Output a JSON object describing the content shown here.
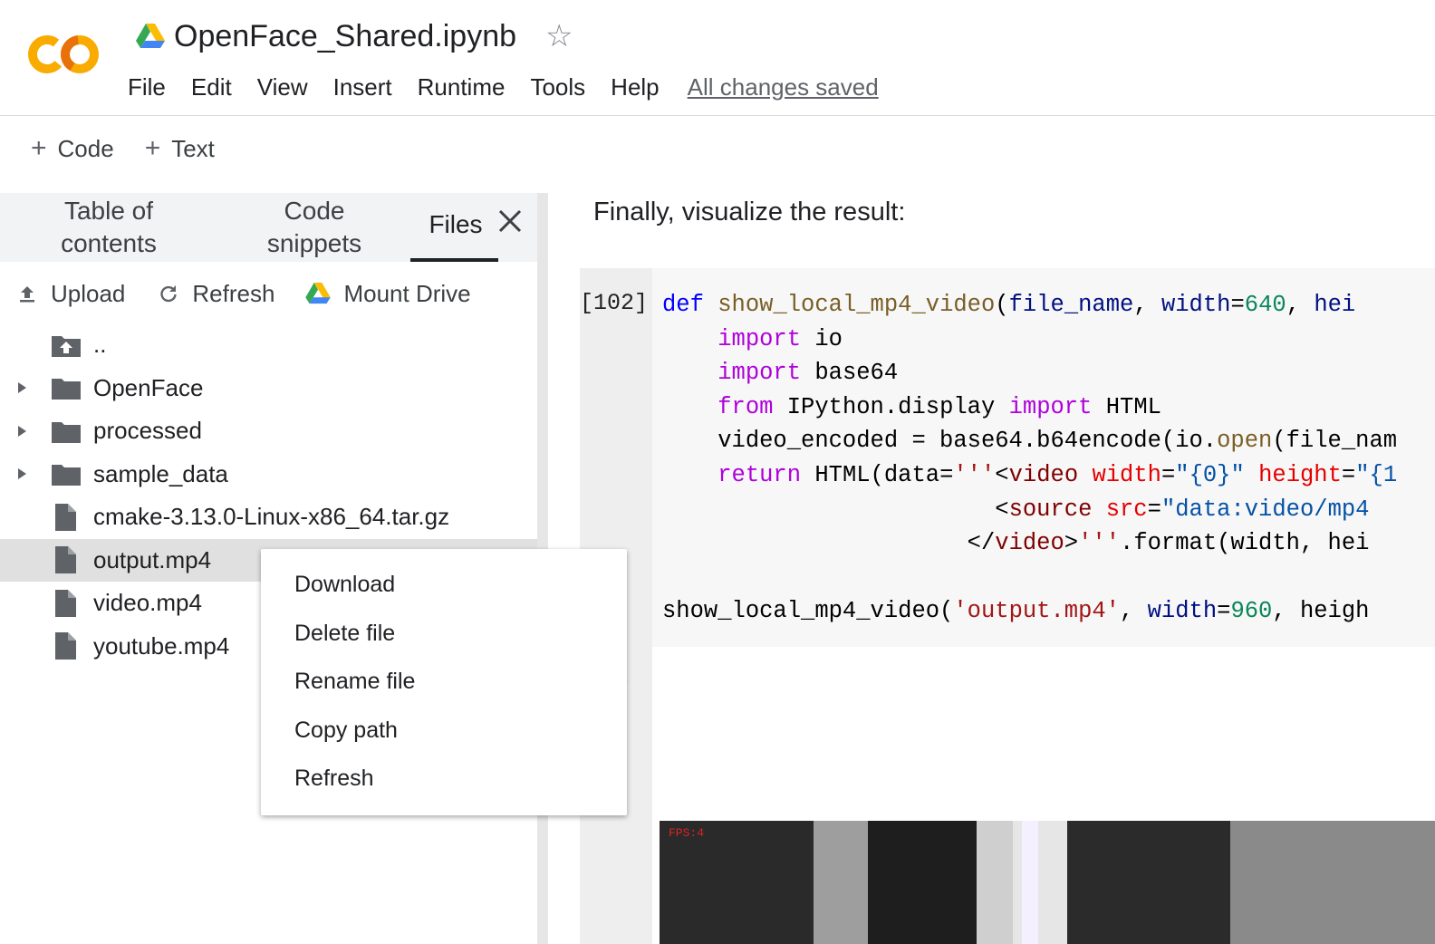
{
  "header": {
    "logo_text": "CO",
    "doc_title": "OpenFace_Shared.ipynb",
    "menu": [
      "File",
      "Edit",
      "View",
      "Insert",
      "Runtime",
      "Tools",
      "Help"
    ],
    "save_status": "All changes saved"
  },
  "toolbar": {
    "add_code_label": "Code",
    "add_text_label": "Text"
  },
  "sidebar": {
    "tabs": [
      {
        "label": "Table of contents"
      },
      {
        "label": "Code snippets"
      },
      {
        "label": "Files"
      }
    ],
    "actions": {
      "upload": "Upload",
      "refresh": "Refresh",
      "mount_drive": "Mount Drive"
    },
    "items": [
      {
        "label": "..",
        "type": "parent"
      },
      {
        "label": "OpenFace",
        "type": "folder"
      },
      {
        "label": "processed",
        "type": "folder"
      },
      {
        "label": "sample_data",
        "type": "folder"
      },
      {
        "label": "cmake-3.13.0-Linux-x86_64.tar.gz",
        "type": "file"
      },
      {
        "label": "output.mp4",
        "type": "file",
        "selected": true
      },
      {
        "label": "video.mp4",
        "type": "file"
      },
      {
        "label": "youtube.mp4",
        "type": "file"
      }
    ]
  },
  "context_menu": {
    "items": [
      "Download",
      "Delete file",
      "Rename file",
      "Copy path",
      "Refresh"
    ]
  },
  "notebook": {
    "text_cell": "Finally, visualize the result:",
    "exec_count": "[102]",
    "code_lines": [
      "def show_local_mp4_video(file_name, width=640, hei",
      "    import io",
      "    import base64",
      "    from IPython.display import HTML",
      "    video_encoded = base64.b64encode(io.open(file_nam",
      "    return HTML(data='''<video width=\"{0}\" height=\"{1",
      "                        <source src=\"data:video/mp4",
      "                      </video>'''.format(width, hei",
      "",
      "show_local_mp4_video('output.mp4', width=960, heigh"
    ],
    "video_overlay": "FPS:4"
  }
}
